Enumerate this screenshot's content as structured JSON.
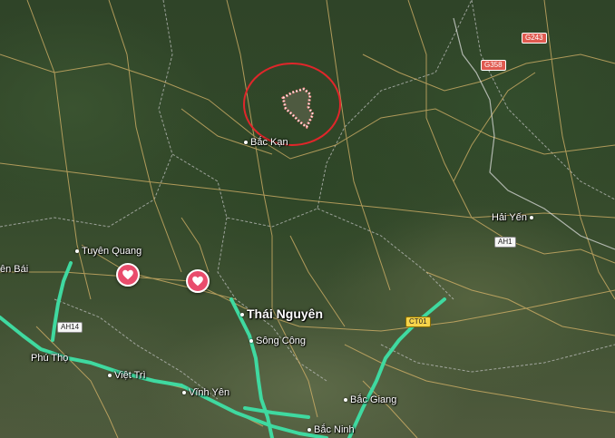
{
  "places": {
    "bac_kan": "Bắc Kạn",
    "hai_yen": "Hải Yến",
    "tuyen_quang": "Tuyên Quang",
    "yen_bai": "ên Bái",
    "thai_nguyen": "Thái Nguyên",
    "song_cong": "Sông Công",
    "phu_tho": "Phú Thọ",
    "viet_tri": "Việt Trì",
    "vinh_yen": "Vĩnh Yên",
    "bac_giang": "Bắc Giang",
    "bac_ninh": "Bắc Ninh"
  },
  "route_shields": {
    "g243": "G243",
    "g358": "G358",
    "ah1": "AH1",
    "ah14": "AH14",
    "ct01": "CT01"
  },
  "icons": {
    "saved_place_pin": "heart-icon",
    "highlight": "red-circle"
  },
  "colors": {
    "highway": "#3fd9a0",
    "road": "#d9b56a",
    "border": "#cfcfcf",
    "highlight_circle": "#e0262a",
    "pin": "#e94c6c"
  }
}
